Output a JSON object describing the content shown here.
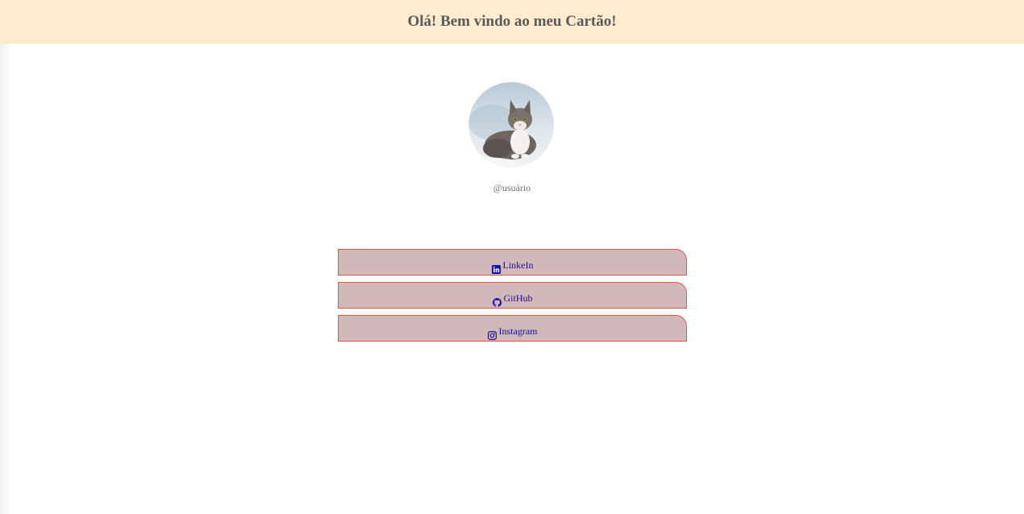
{
  "header": {
    "title": "Olá! Bem vindo ao meu Cartão!"
  },
  "profile": {
    "username": "@usuário",
    "avatar_icon": "cat-photo"
  },
  "links": [
    {
      "label": "LinkeIn",
      "icon": "linkedin-icon"
    },
    {
      "label": "GitHub",
      "icon": "github-icon"
    },
    {
      "label": "Instagram",
      "icon": "instagram-icon"
    }
  ],
  "colors": {
    "header_bg": "#ffecce",
    "button_bg": "#d1b9b9",
    "button_border": "#e9533f",
    "link_text": "#1a0dab"
  }
}
